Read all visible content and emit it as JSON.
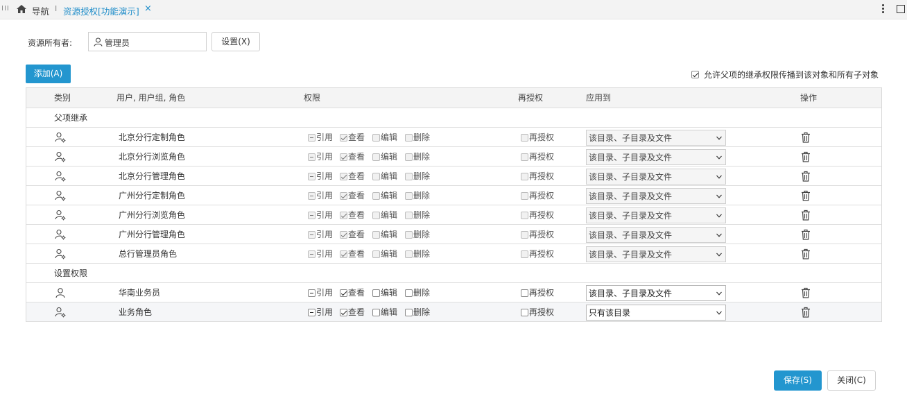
{
  "tabs": {
    "nav_label": "导航",
    "active_label": "资源授权[功能演示]",
    "close_glyph": "×"
  },
  "owner": {
    "label": "资源所有者:",
    "value": "管理员",
    "set_button": "设置(X)"
  },
  "toolbar": {
    "add_button": "添加(A)",
    "allow_inherit_label": "允许父项的继承权限传播到该对象和所有子对象",
    "allow_inherit_checked": true
  },
  "table": {
    "headers": {
      "type": "类别",
      "user": "用户, 用户组, 角色",
      "perm": "权限",
      "regrant": "再授权",
      "apply": "应用到",
      "ops": "操作"
    },
    "perm_labels": {
      "ref": "引用",
      "view": "查看",
      "edit": "编辑",
      "delete": "删除",
      "regrant": "再授权"
    },
    "groups": {
      "inherited": "父项继承",
      "assigned": "设置权限"
    },
    "inherited_rows": [
      {
        "name": "北京分行定制角色",
        "apply": "该目录、子目录及文件"
      },
      {
        "name": "北京分行浏览角色",
        "apply": "该目录、子目录及文件"
      },
      {
        "name": "北京分行管理角色",
        "apply": "该目录、子目录及文件"
      },
      {
        "name": "广州分行定制角色",
        "apply": "该目录、子目录及文件"
      },
      {
        "name": "广州分行浏览角色",
        "apply": "该目录、子目录及文件"
      },
      {
        "name": "广州分行管理角色",
        "apply": "该目录、子目录及文件"
      },
      {
        "name": "总行管理员角色",
        "apply": "该目录、子目录及文件"
      }
    ],
    "assigned_rows": [
      {
        "name": "华南业务员",
        "apply": "该目录、子目录及文件"
      },
      {
        "name": "业务角色",
        "apply": "只有该目录"
      }
    ]
  },
  "footer": {
    "save_button": "保存(S)",
    "close_button": "关闭(C)"
  },
  "colors": {
    "accent": "#2396cf",
    "tab_active": "#1f8dc9"
  }
}
